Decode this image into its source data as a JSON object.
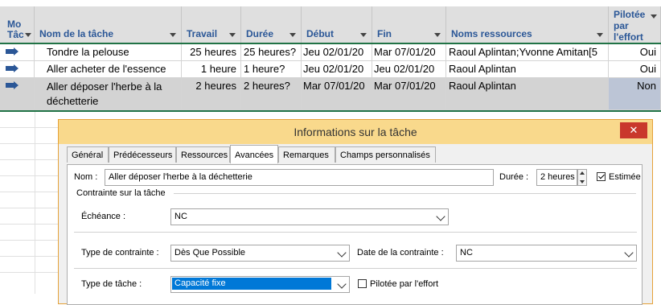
{
  "columns": {
    "mode": "Mo Tâc",
    "name": "Nom de la tâche",
    "work": "Travail",
    "duration": "Durée",
    "start": "Début",
    "finish": "Fin",
    "resources": "Noms ressources",
    "effort": "Pilotée par l'effort"
  },
  "rows": [
    {
      "name": "Tondre la pelouse",
      "work": "25 heures",
      "duration": "25 heures?",
      "start": "Jeu 02/01/20",
      "finish": "Mar 07/01/20",
      "resources": "Raoul Aplintan;Yvonne Amitan[5",
      "effort": "Oui"
    },
    {
      "name": "Aller acheter de l'essence",
      "work": "1 heure",
      "duration": "1 heure?",
      "start": "Jeu 02/01/20",
      "finish": "Jeu 02/01/20",
      "resources": "Raoul Aplintan",
      "effort": "Oui"
    },
    {
      "name_line1": "Aller déposer l'herbe à la",
      "name_line2": "déchetterie",
      "work": "2 heures",
      "duration": "2 heures?",
      "start": "Mar 07/01/20",
      "finish": "Mar 07/01/20",
      "resources": "Raoul Aplintan",
      "effort": "Non"
    }
  ],
  "dialog": {
    "title": "Informations sur la tâche",
    "close": "✕",
    "tabs": [
      "Général",
      "Prédécesseurs",
      "Ressources",
      "Avancées",
      "Remarques",
      "Champs personnalisés"
    ],
    "name_label": "Nom :",
    "name_value": "Aller déposer l'herbe à la déchetterie",
    "duration_label": "Durée :",
    "duration_value": "2 heures",
    "estimated_label": "Estimée",
    "constraint_group": "Contrainte sur la tâche",
    "deadline_label": "Échéance :",
    "deadline_value": "NC",
    "constraint_type_label": "Type de contrainte :",
    "constraint_type_value": "Dès Que Possible",
    "constraint_date_label": "Date de la contrainte :",
    "constraint_date_value": "NC",
    "task_type_label": "Type de tâche :",
    "task_type_value": "Capacité fixe",
    "effort_driven_label": "Pilotée par l'effort"
  },
  "colors": {
    "accent_green": "#217346",
    "header_text": "#2b5797",
    "dialog_title_bg": "#f9d98c",
    "close_bg": "#c9372c"
  }
}
